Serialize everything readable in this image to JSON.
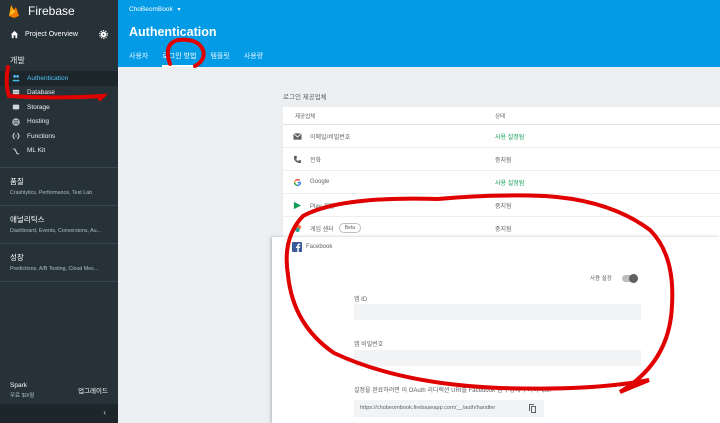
{
  "app": {
    "name": "Firebase"
  },
  "sidebar": {
    "project_overview": "Project Overview",
    "develop_title": "개발",
    "develop_items": [
      {
        "label": "Authentication",
        "icon": "people-icon",
        "active": true
      },
      {
        "label": "Database",
        "icon": "database-icon",
        "active": false
      },
      {
        "label": "Storage",
        "icon": "storage-icon",
        "active": false
      },
      {
        "label": "Hosting",
        "icon": "globe-icon",
        "active": false
      },
      {
        "label": "Functions",
        "icon": "functions-icon",
        "active": false
      },
      {
        "label": "ML Kit",
        "icon": "ml-icon",
        "active": false
      }
    ],
    "quality": {
      "title": "품질",
      "subtitle": "Crashlytics, Performance, Test Lab"
    },
    "analytics": {
      "title": "애널리틱스",
      "subtitle": "Dashboard, Events, Conversions, Au..."
    },
    "grow": {
      "title": "성장",
      "subtitle": "Predictions, A/B Testing, Cloud Mes..."
    },
    "plan": {
      "name": "Spark",
      "price": "무료 $0/월",
      "upgrade": "업그레이드"
    },
    "collapse_glyph": "‹"
  },
  "header": {
    "project": "ChoBeomBook",
    "project_caret": "▾",
    "title": "Authentication",
    "tabs": [
      "사용자",
      "로그인 방법",
      "템플릿",
      "사용량"
    ],
    "active_tab": 1
  },
  "providers": {
    "label": "로그인 제공업체",
    "col_provider": "제공업체",
    "col_status": "상태",
    "rows": [
      {
        "name": "이메일/비밀번호",
        "status": "사용 설정됨",
        "enabled": true
      },
      {
        "name": "전화",
        "status": "중지됨",
        "enabled": false
      },
      {
        "name": "Google",
        "status": "사용 설정됨",
        "enabled": true
      },
      {
        "name": "Play 게임",
        "status": "중지됨",
        "enabled": false
      },
      {
        "name": "게임 센터",
        "badge": "Beta",
        "status": "중지됨",
        "enabled": false
      }
    ]
  },
  "facebook": {
    "title": "Facebook",
    "enable_label": "사용 설정",
    "app_id_label": "앱 ID",
    "app_secret_label": "앱 비밀번호",
    "note": "설정을 완료하려면 이 OAuth 리디렉션 URI를 Facebook 앱 구성에 추가하세요.",
    "redirect_uri": "https://chobeombook.firebaseapp.com/__/auth/handler"
  },
  "colors": {
    "sidebar": "#263238",
    "header": "#039be5",
    "accent": "#4fc3f7",
    "enabled": "#0f9d58",
    "annotation": "#e00000"
  }
}
